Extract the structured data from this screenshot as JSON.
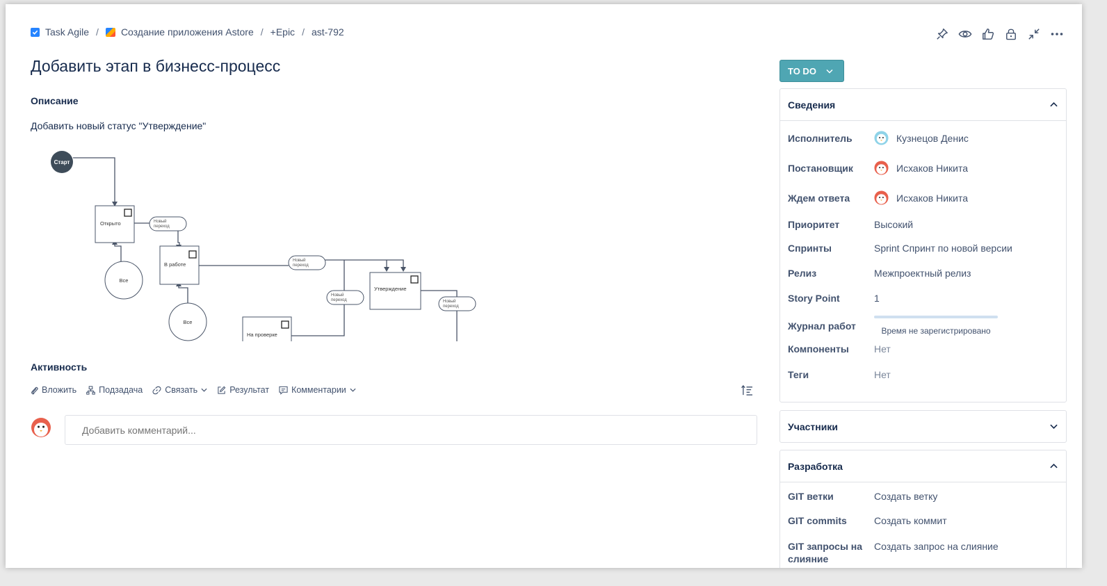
{
  "breadcrumb": {
    "project": "Task Agile",
    "app": "Создание приложения Astore",
    "epic": "+Epic",
    "key": "ast-792",
    "sep": "/"
  },
  "issue": {
    "title": "Добавить этап в бизнесс-процесс",
    "description_heading": "Описание",
    "description": "Добавить новый статус \"Утверждение\""
  },
  "diagram": {
    "start": "Старт",
    "open": "Открыто",
    "in_work": "В работе",
    "approval": "Утверждение",
    "review": "На проверке",
    "all1": "Все",
    "all2": "Все",
    "transition_l1": "Новый",
    "transition_l2": "переход"
  },
  "activity": {
    "heading": "Активность",
    "attach": "Вложить",
    "subtask": "Подзадача",
    "link": "Связать",
    "result": "Результат",
    "comments": "Комментарии",
    "comment_placeholder": "Добавить комментарий..."
  },
  "status": {
    "label": "TO DO",
    "color": "#4fa6b3"
  },
  "details": {
    "heading": "Сведения",
    "assignee_label": "Исполнитель",
    "assignee": "Кузнецов Денис",
    "reporter_label": "Постановщик",
    "reporter": "Исхаков Никита",
    "waiting_label": "Ждем ответа",
    "waiting": "Исхаков Никита",
    "priority_label": "Приоритет",
    "priority": "Высокий",
    "sprints_label": "Спринты",
    "sprints": "Sprint Спринт по новой версии",
    "release_label": "Релиз",
    "release": "Межпроектный релиз",
    "story_label": "Story Point",
    "story": "1",
    "worklog_label": "Журнал работ",
    "worklog": "Время не зарегистрировано",
    "components_label": "Компоненты",
    "components": "Нет",
    "tags_label": "Теги",
    "tags": "Нет"
  },
  "participants": {
    "heading": "Участники"
  },
  "development": {
    "heading": "Разработка",
    "branches_label": "GIT ветки",
    "branches": "Создать ветку",
    "commits_label": "GIT commits",
    "commits": "Создать коммит",
    "mr_label_1": "GIT запросы на",
    "mr_label_2": "слияние",
    "mr": "Создать запрос на слияние"
  }
}
